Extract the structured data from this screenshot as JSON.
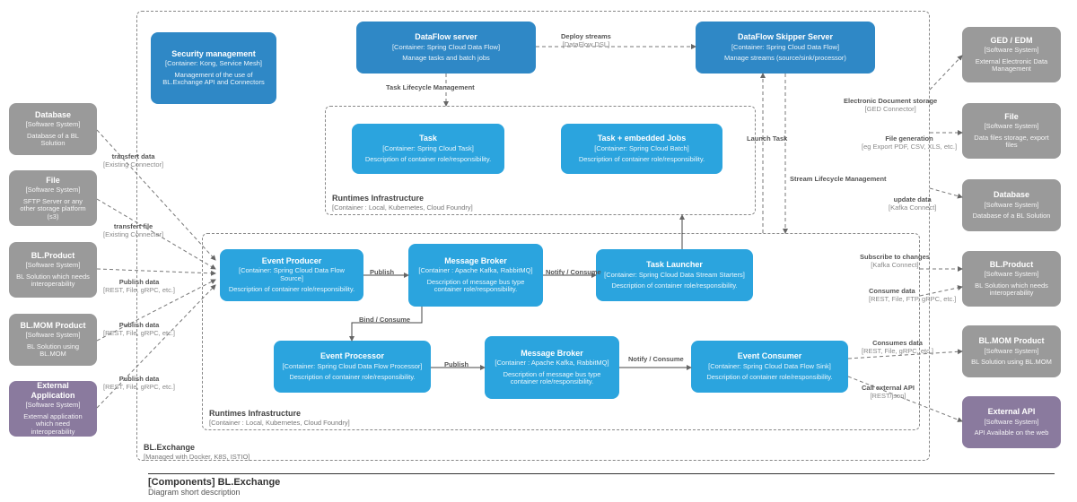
{
  "caption": {
    "title": "[Components] BL.Exchange",
    "subtitle": "Diagram short description"
  },
  "outer": {
    "title": "BL.Exchange",
    "subtitle": "[Managed with Docker, K8S, ISTIO]"
  },
  "runtimes": {
    "title": "Runtimes Infrastructure",
    "subtitle": "[Container : Local, Kubernetes, Cloud Foundry]"
  },
  "left": {
    "database": {
      "title": "Database",
      "sub": "[Software System]",
      "desc": "Database of a BL Solution"
    },
    "file": {
      "title": "File",
      "sub": "[Software System]",
      "desc": "SFTP Server or any other storage platform (s3)"
    },
    "product": {
      "title": "BL.Product",
      "sub": "[Software System]",
      "desc": "BL Solution which needs interoperability"
    },
    "mom": {
      "title": "BL.MOM Product",
      "sub": "[Software System]",
      "desc": "BL Solution using BL.MOM"
    },
    "extapp": {
      "title": "External Application",
      "sub": "[Software System]",
      "desc": "External application which need interoperability"
    }
  },
  "right": {
    "ged": {
      "title": "GED / EDM",
      "sub": "[Software System]",
      "desc": "External Electronic Data Management"
    },
    "file": {
      "title": "File",
      "sub": "[Software System]",
      "desc": "Data files storage, export files"
    },
    "database": {
      "title": "Database",
      "sub": "[Software System]",
      "desc": "Database of a BL Solution"
    },
    "product": {
      "title": "BL.Product",
      "sub": "[Software System]",
      "desc": "BL Solution which needs interoperability"
    },
    "mom": {
      "title": "BL.MOM Product",
      "sub": "[Software System]",
      "desc": "BL Solution using BL.MOM"
    },
    "extapi": {
      "title": "External API",
      "sub": "[Software System]",
      "desc": "API Available on the web"
    }
  },
  "inner": {
    "security": {
      "title": "Security management",
      "sub": "[Container: Kong, Service Mesh]",
      "desc": "Management of the use of BL.Exchange API and Connectors"
    },
    "dfserver": {
      "title": "DataFlow server",
      "sub": "[Container: Spring Cloud Data Flow]",
      "desc": "Manage tasks and batch jobs"
    },
    "skipper": {
      "title": "DataFlow Skipper Server",
      "sub": "[Container: Spring Cloud Data Flow]",
      "desc": "Manage streams (source/sink/processor)"
    },
    "task": {
      "title": "Task",
      "sub": "[Container: Spring Cloud Task]",
      "desc": "Description of container role/responsibility."
    },
    "taskjobs": {
      "title": "Task + embedded Jobs",
      "sub": "[Container: Spring Cloud Batch]",
      "desc": "Description of container role/responsibility."
    },
    "producer": {
      "title": "Event Producer",
      "sub": "[Container: Spring Cloud Data Flow Source]",
      "desc": "Description of container role/responsibility."
    },
    "broker1": {
      "title": "Message Broker",
      "sub": "[Container : Apache Kafka, RabbitMQ]",
      "desc": "Description of message bus type container role/responsibility."
    },
    "launcher": {
      "title": "Task Launcher",
      "sub": "[Container: Spring Cloud Data Stream Starters]",
      "desc": "Description of container role/responsibility."
    },
    "processor": {
      "title": "Event Processor",
      "sub": "[Container: Spring Cloud Data Flow Processor]",
      "desc": "Description of container role/responsibility."
    },
    "broker2": {
      "title": "Message Broker",
      "sub": "[Container : Apache Kafka, RabbitMQ]",
      "desc": "Description of message bus type container role/responsibility."
    },
    "consumer": {
      "title": "Event Consumer",
      "sub": "[Container: Spring Cloud Data Flow Sink]",
      "desc": "Description of container role/responsibility."
    }
  },
  "edges": {
    "deploy": {
      "t": "Deploy streams",
      "s": "[DataFlow DSL]"
    },
    "tlm": {
      "t": "Task Lifecycle Management",
      "s": ""
    },
    "launchtask": {
      "t": "Launch Task",
      "s": ""
    },
    "slm": {
      "t": "Stream Lifecycle Management",
      "s": ""
    },
    "geds": {
      "t": "Electronic Document storage",
      "s": "[GED Connector]"
    },
    "filegen": {
      "t": "File generation",
      "s": "[eg Export PDF, CSV, XLS, etc.]"
    },
    "upddata": {
      "t": "update data",
      "s": "[Kafka Connect]"
    },
    "sub": {
      "t": "Subscribe to changes",
      "s": "[Kafka Connect]"
    },
    "consdata": {
      "t": "Consume data",
      "s": "[REST, File, FTP, gRPC, etc.]"
    },
    "consdata2": {
      "t": "Consumes data",
      "s": "[REST, File, gRPC, etc.]"
    },
    "callapi": {
      "t": "Call external API",
      "s": "[REST/json]"
    },
    "tdata": {
      "t": "transfert data",
      "s": "[Existing Connector]"
    },
    "tfile": {
      "t": "transfert file",
      "s": "[Existing Connector]"
    },
    "pub1": {
      "t": "Publish data",
      "s": "[REST, File, gRPC, etc.]"
    },
    "pub2": {
      "t": "Publish data",
      "s": "[REST, File, gRPC, etc.]"
    },
    "pub3": {
      "t": "Publish data",
      "s": "[REST, File, gRPC, etc.]"
    },
    "publish": {
      "t": "Publish",
      "s": ""
    },
    "publish2": {
      "t": "Publish",
      "s": ""
    },
    "notify": {
      "t": "Notify / Consume",
      "s": ""
    },
    "notify2": {
      "t": "Notify / Consume",
      "s": ""
    },
    "bind": {
      "t": "Bind / Consume",
      "s": ""
    }
  }
}
